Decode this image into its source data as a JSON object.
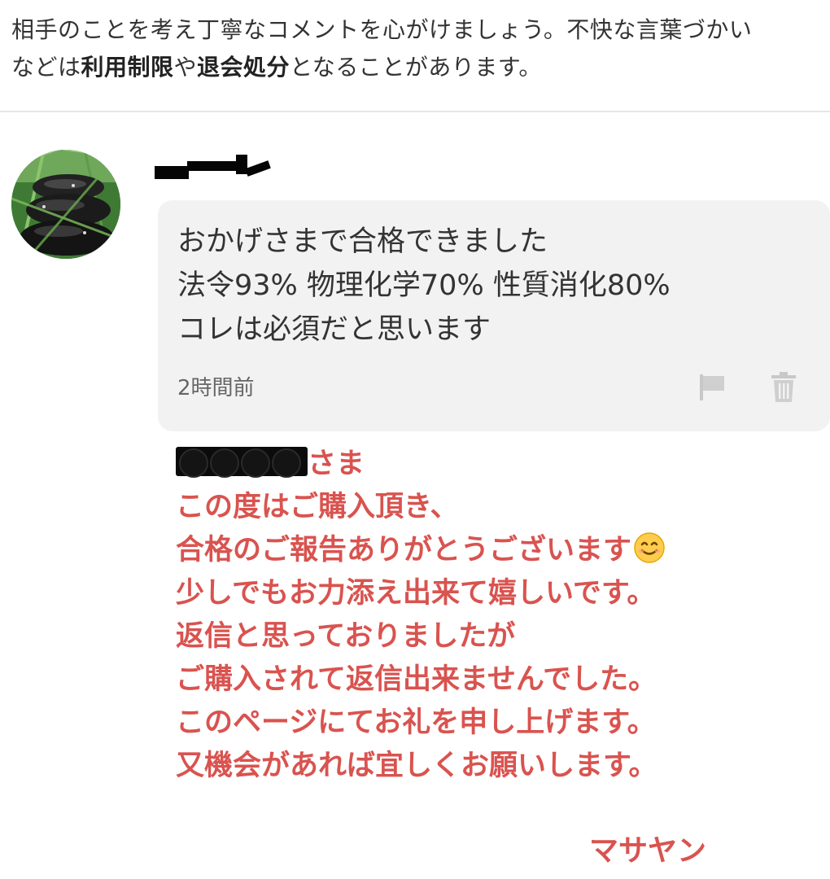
{
  "notice": {
    "line1": "相手のことを考え丁寧なコメントを心がけましょう。不快な言葉づかい",
    "line2_prefix": "などは",
    "line2_bold1": "利用制限",
    "line2_mid": "や",
    "line2_bold2": "退会処分",
    "line2_suffix": "となることがあります。"
  },
  "comment": {
    "lines": [
      "おかげさまで合格できました",
      "法令93%  物理化学70%  性質消化80%",
      "コレは必須だと思います"
    ],
    "timestamp": "2時間前",
    "icons": {
      "flag": "flag-icon",
      "delete": "trash-icon"
    }
  },
  "reply": {
    "salutation_suffix": "さま",
    "lines": [
      "この度はご購入頂き、",
      "合格のご報告ありがとうございます",
      "少しでもお力添え出来て嬉しいです。",
      "返信と思っておりましたが",
      "ご購入されて返信出来ませんでした。",
      "このページにてお礼を申し上げます。",
      "又機会があれば宜しくお願いします。"
    ],
    "emoji": "smiling-face-icon",
    "signature": "マサヤン",
    "color": "#d9534f"
  }
}
